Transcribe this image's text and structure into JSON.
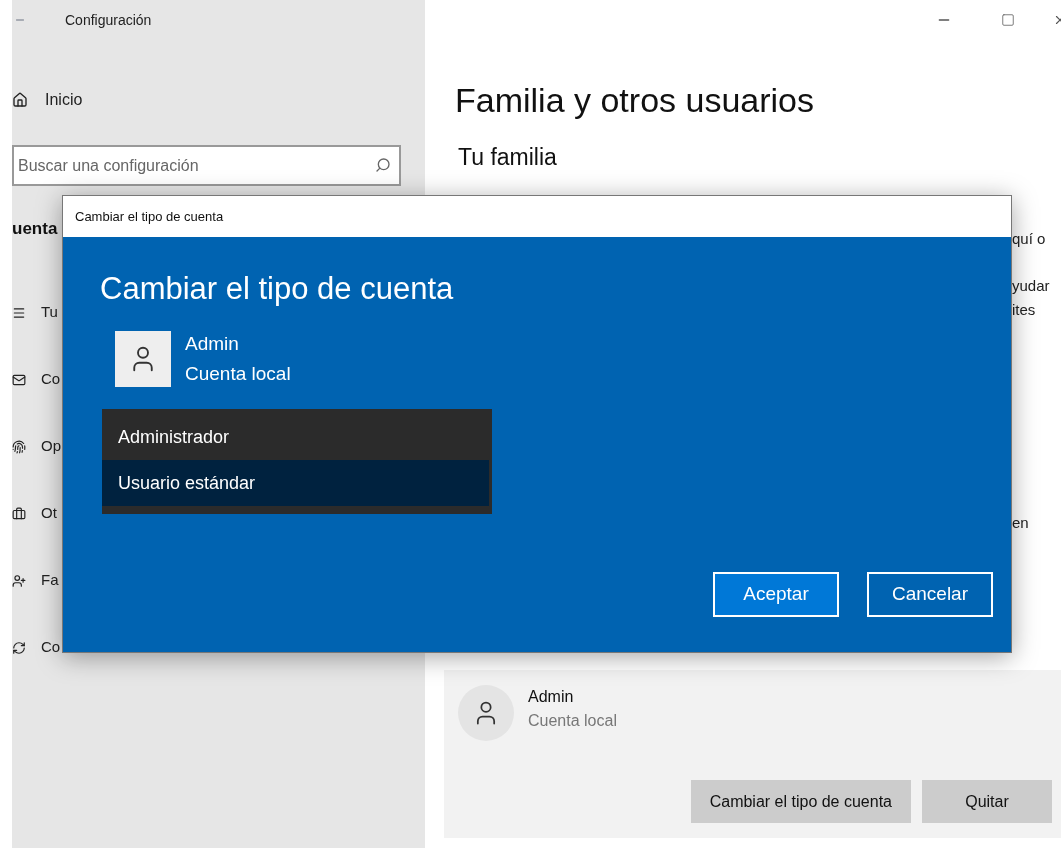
{
  "window": {
    "title": "Configuración"
  },
  "sidebar": {
    "home": "Inicio",
    "search": {
      "placeholder": "Buscar una configuración"
    },
    "section": "uenta",
    "items": [
      "Tu",
      "Co",
      "Op",
      "Ot",
      "Fa",
      "Co"
    ]
  },
  "main": {
    "title": "Familia y otros usuarios",
    "section": "Tu familia",
    "fragments": [
      "quí o",
      "yudar",
      "ites",
      "en"
    ],
    "account_card": {
      "name": "Admin",
      "type": "Cuenta local",
      "buttons": [
        "Cambiar el tipo de cuenta",
        "Quitar"
      ]
    }
  },
  "dialog": {
    "title": "Cambiar el tipo de cuenta",
    "heading": "Cambiar el tipo de cuenta",
    "account": {
      "name": "Admin",
      "type": "Cuenta local"
    },
    "options": [
      {
        "label": "Administrador",
        "selected": false
      },
      {
        "label": "Usuario estándar",
        "selected": true
      }
    ],
    "buttons": [
      {
        "label": "Aceptar",
        "kind": "primary"
      },
      {
        "label": "Cancelar",
        "kind": "secondary"
      }
    ]
  }
}
